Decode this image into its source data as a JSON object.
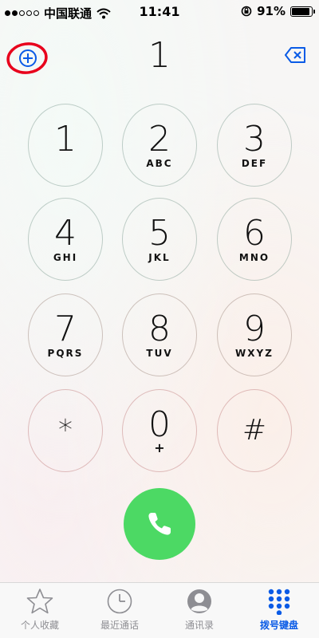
{
  "status_bar": {
    "carrier": "中国联通",
    "time": "11:41",
    "battery": "91%",
    "battery_level": 0.91
  },
  "dialer": {
    "entered_number": "1",
    "add_contact_icon": "plus-circle-icon",
    "delete_icon": "backspace-icon"
  },
  "keys": [
    {
      "digit": "1",
      "letters": ""
    },
    {
      "digit": "2",
      "letters": "ABC"
    },
    {
      "digit": "3",
      "letters": "DEF"
    },
    {
      "digit": "4",
      "letters": "GHI"
    },
    {
      "digit": "5",
      "letters": "JKL"
    },
    {
      "digit": "6",
      "letters": "MNO"
    },
    {
      "digit": "7",
      "letters": "PQRS"
    },
    {
      "digit": "8",
      "letters": "TUV"
    },
    {
      "digit": "9",
      "letters": "WXYZ"
    },
    {
      "digit": "*",
      "letters": ""
    },
    {
      "digit": "0",
      "letters": "+"
    },
    {
      "digit": "#",
      "letters": ""
    }
  ],
  "call_button": {
    "icon": "phone-icon",
    "color": "#4cd964"
  },
  "tabs": [
    {
      "label": "个人收藏",
      "icon": "star-icon",
      "active": false
    },
    {
      "label": "最近通话",
      "icon": "clock-icon",
      "active": false
    },
    {
      "label": "通讯录",
      "icon": "contact-icon",
      "active": false
    },
    {
      "label": "拨号键盘",
      "icon": "keypad-icon",
      "active": true
    }
  ],
  "colors": {
    "accent": "#0a5be6",
    "highlight_circle": "#e8001c"
  }
}
